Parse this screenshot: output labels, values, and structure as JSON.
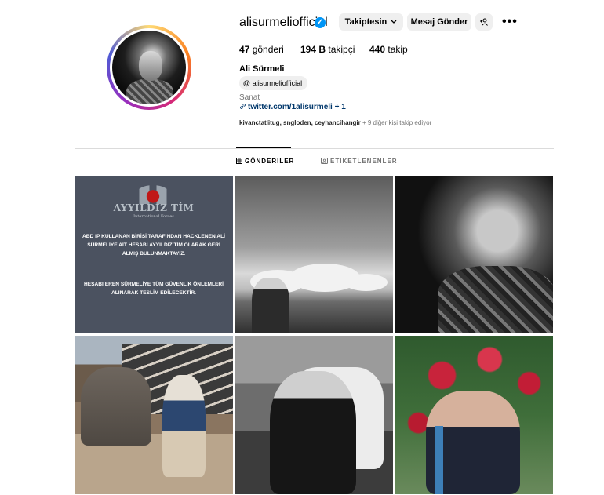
{
  "profile": {
    "username": "alisurmeliofficial",
    "verified_mark": "✓",
    "buttons": {
      "following": "Takiptesin",
      "message": "Mesaj Gönder",
      "add_person": "+웃",
      "more": "•••"
    },
    "stats": {
      "posts_count": "47",
      "posts_label": "gönderi",
      "followers_count": "194 B",
      "followers_label": "takipçi",
      "following_count": "440",
      "following_label": "takip"
    },
    "full_name": "Ali Sürmeli",
    "threads_handle": "alisurmeliofficial",
    "category": "Sanat",
    "link_text": "twitter.com/1alisurmeli",
    "link_extra": "+ 1",
    "followed_by": {
      "names": "kivanctatlitug, sngloden, ceyhancihangir",
      "suffix": "+ 9 diğer kişi takip ediyor"
    }
  },
  "tabs": {
    "posts": "GÖNDERİLER",
    "tagged": "ETİKETLENENLER"
  },
  "posts": [
    {
      "logo_text": "AYYILDIZ TİM",
      "logo_sub": "International Forces",
      "notice_1": "ABD IP KULLANAN BİRİSİ TARAFINDAN HACKLENEN ALİ SÜRMELİYE AİT HESABI AYYILDIZ TİM OLARAK GERİ ALMIŞ BULUNMAKTAYIZ.",
      "notice_2": "HESABI EREN SÜRMELİYE TÜM GÜVENLİK ÖNLEMLERİ ALINARAK TESLİM EDİLECEKTİR."
    }
  ],
  "colors": {
    "verified": "#0095f6",
    "link": "#00376b",
    "button_bg": "#efefef"
  },
  "icons": {
    "verified": "verified-badge-icon",
    "threads": "threads-icon",
    "link": "link-icon",
    "posts_tab": "grid-icon",
    "tagged_tab": "tag-icon",
    "chevron": "chevron-down-icon"
  }
}
